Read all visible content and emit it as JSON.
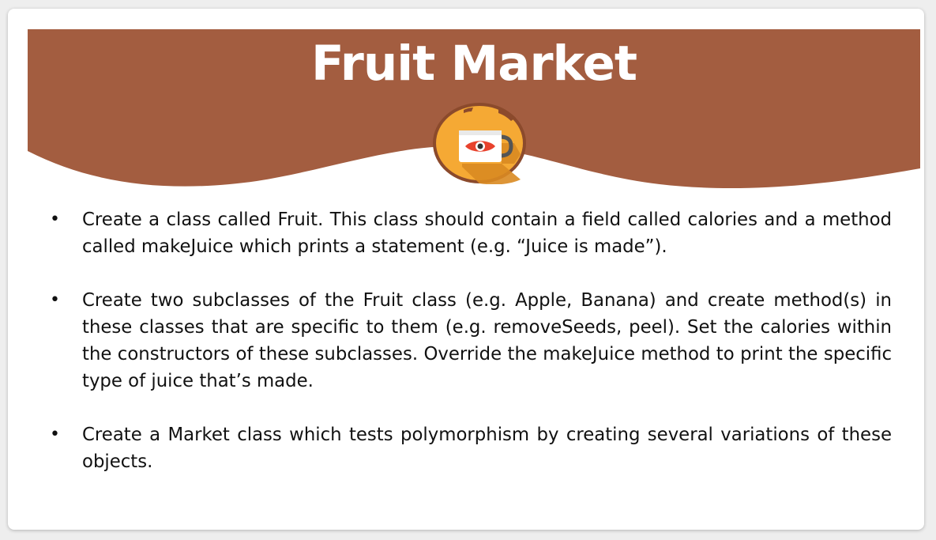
{
  "slide": {
    "title": "Fruit Market",
    "colors": {
      "header": "#a35d40",
      "logo_circle": "#f5a934",
      "logo_ring": "#8b4a2c",
      "logo_shadow": "#d98a21",
      "accent_eye": "#e8422d"
    },
    "logo_icon": "coffee-mug-eye-icon",
    "bullets": [
      {
        "marker": "•",
        "text": "Create a class called Fruit. This class should contain a field called calories and a method called makeJuice which prints a statement (e.g. “Juice is made”)."
      },
      {
        "marker": "•",
        "text": "Create two subclasses of the Fruit class (e.g. Apple, Banana) and create method(s) in these classes that are specific to them (e.g. removeSeeds, peel). Set the calories within the constructors of these subclasses. Override the makeJuice method to print the specific type of juice that’s made."
      },
      {
        "marker": "•",
        "text": "Create a Market class which tests polymorphism by creating several variations of these objects."
      }
    ]
  }
}
